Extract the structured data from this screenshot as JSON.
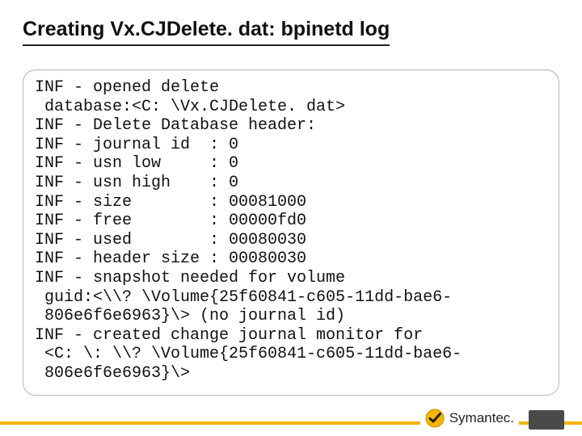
{
  "title": "Creating Vx.CJDelete. dat: bpinetd log",
  "log": {
    "lines": [
      "INF - opened delete",
      " database:<C: \\Vx.CJDelete. dat>",
      "INF - Delete Database header:",
      "INF - journal id  : 0",
      "INF - usn low     : 0",
      "INF - usn high    : 0",
      "INF - size        : 00081000",
      "INF - free        : 00000fd0",
      "INF - used        : 00080030",
      "INF - header size : 00080030",
      "INF - snapshot needed for volume",
      " guid:<\\\\? \\Volume{25f60841-c605-11dd-bae6-",
      " 806e6f6e6963}\\> (no journal id)",
      "INF - created change journal monitor for",
      " <C: \\: \\\\? \\Volume{25f60841-c605-11dd-bae6-",
      " 806e6f6e6963}\\>"
    ]
  },
  "brand": {
    "name": "Symantec."
  },
  "colors": {
    "accent": "#f0b400",
    "footerTab": "#4a4a4a"
  }
}
